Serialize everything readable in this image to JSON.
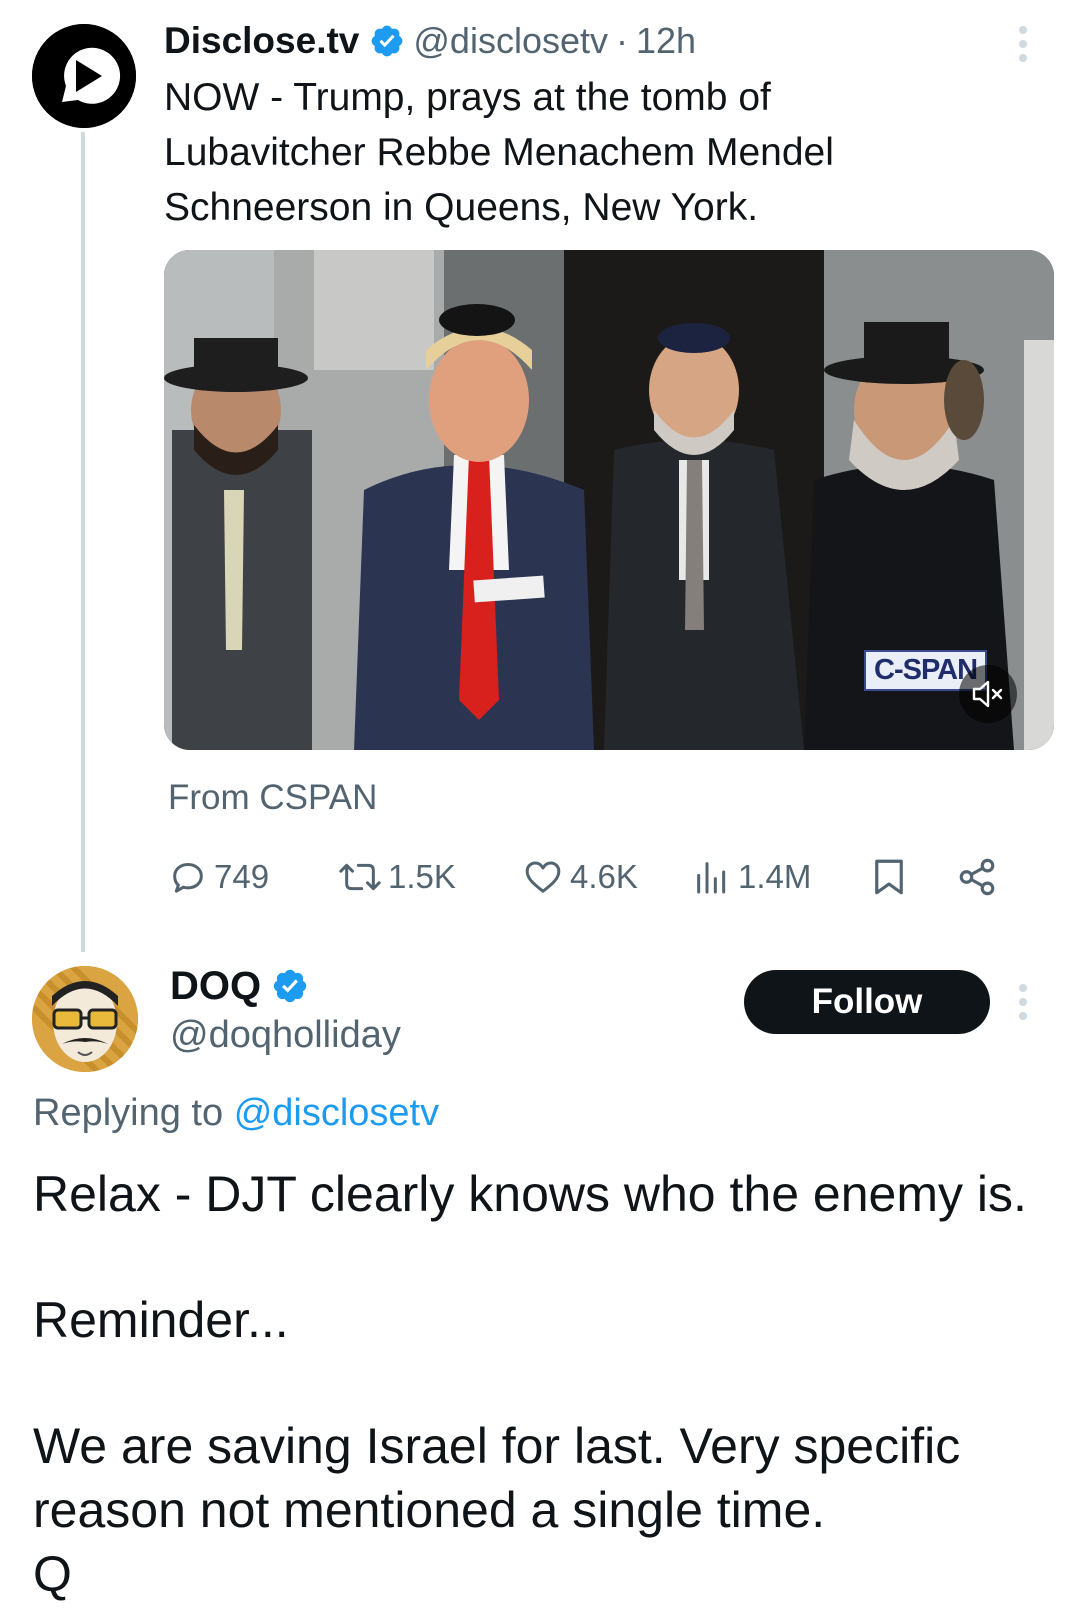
{
  "parent_tweet": {
    "display_name": "Disclose.tv",
    "handle": "@disclosetv",
    "separator": "·",
    "time": "12h",
    "text": "NOW - Trump, prays at the tomb of\nLubavitcher Rebbe Menachem Mendel\nSchneerson in Queens, New York.",
    "media": {
      "watermark": "C-SPAN",
      "mute_icon": "speaker-muted-icon"
    },
    "source": "From CSPAN",
    "stats": {
      "replies": "749",
      "reposts": "1.5K",
      "likes": "4.6K",
      "views": "1.4M"
    }
  },
  "reply_tweet": {
    "display_name": "DOQ",
    "handle": "@doqholliday",
    "follow_label": "Follow",
    "replying_prefix": "Replying to",
    "replying_mention": "@disclosetv",
    "lines": [
      "Relax - DJT clearly knows who the enemy is.",
      "Reminder...",
      "We are saving Israel for last. Very specific",
      "reason not mentioned a single time.",
      "Q"
    ]
  },
  "colors": {
    "text_primary": "#0f1419",
    "text_secondary": "#536471",
    "accent": "#1d9bf0",
    "follow_button": "#0f1419"
  }
}
